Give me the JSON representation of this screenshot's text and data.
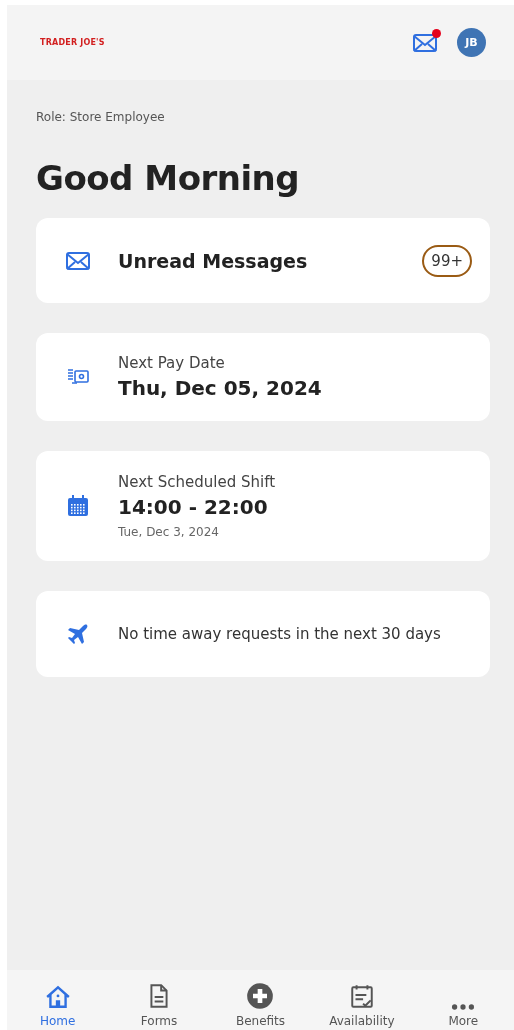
{
  "header": {
    "logo": "TRADER JOE'S",
    "mail_unread": true,
    "avatar": "JB"
  },
  "role": "Role: Store Employee",
  "greeting": "Good Morning",
  "cards": [
    {
      "kind": "messages",
      "title": "Unread Messages",
      "badge": "99+"
    },
    {
      "kind": "pay",
      "label": "Next Pay Date",
      "value": "Thu, Dec 05, 2024"
    },
    {
      "kind": "shift",
      "label": "Next Scheduled Shift",
      "value": "14:00 - 22:00",
      "sub": "Tue, Dec 3, 2024"
    },
    {
      "kind": "timeoff",
      "text": "No time away requests in the next 30 days"
    }
  ],
  "tabs": [
    {
      "kind": "home",
      "label": "Home",
      "selected": true
    },
    {
      "kind": "forms",
      "label": "Forms",
      "selected": false
    },
    {
      "kind": "benefits",
      "label": "Benefits",
      "selected": false
    },
    {
      "kind": "availability",
      "label": "Availability",
      "selected": false
    },
    {
      "kind": "more",
      "label": "More",
      "selected": false
    }
  ]
}
